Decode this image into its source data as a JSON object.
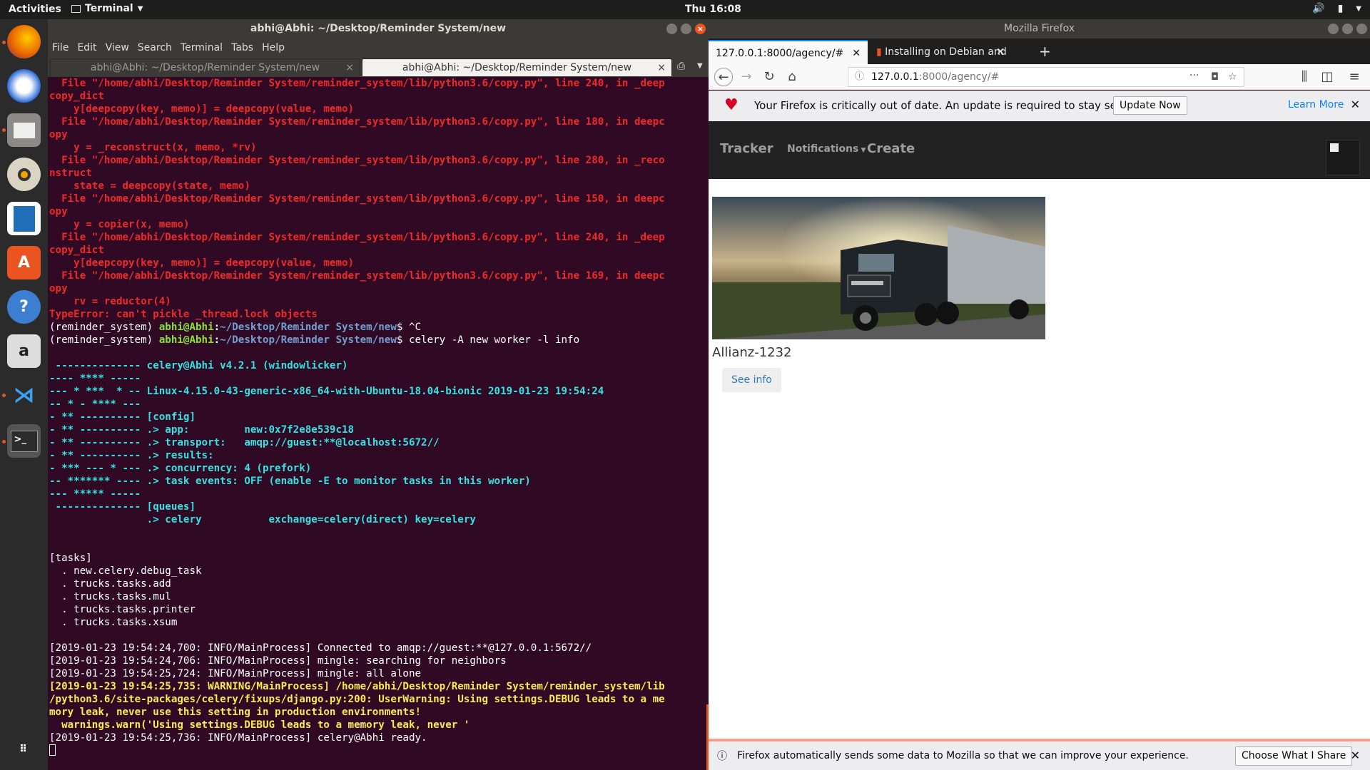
{
  "topbar": {
    "activities": "Activities",
    "app_menu": "Terminal",
    "clock": "Thu 16:08"
  },
  "dock": {
    "items": [
      "firefox-icon",
      "thunderbird-icon",
      "files-icon",
      "rhythmbox-icon",
      "writer-icon",
      "software-icon",
      "help-icon",
      "amazon-icon",
      "vscode-icon",
      "terminal-icon",
      "show-apps-icon"
    ]
  },
  "terminal": {
    "title": "abhi@Abhi: ~/Desktop/Reminder System/new",
    "menu": [
      "File",
      "Edit",
      "View",
      "Search",
      "Terminal",
      "Tabs",
      "Help"
    ],
    "tabs": [
      "abhi@Abhi: ~/Desktop/Reminder System/new",
      "abhi@Abhi: ~/Desktop/Reminder System/new"
    ],
    "lines": [
      {
        "c": "red",
        "t": "  File \"/home/abhi/Desktop/Reminder System/reminder_system/lib/python3.6/copy.py\", line 240, in _deep"
      },
      {
        "c": "red",
        "t": "copy_dict"
      },
      {
        "c": "red",
        "t": "    y[deepcopy(key, memo)] = deepcopy(value, memo)"
      },
      {
        "c": "red",
        "t": "  File \"/home/abhi/Desktop/Reminder System/reminder_system/lib/python3.6/copy.py\", line 180, in deepc"
      },
      {
        "c": "red",
        "t": "opy"
      },
      {
        "c": "red",
        "t": "    y = _reconstruct(x, memo, *rv)"
      },
      {
        "c": "red",
        "t": "  File \"/home/abhi/Desktop/Reminder System/reminder_system/lib/python3.6/copy.py\", line 280, in _reco"
      },
      {
        "c": "red",
        "t": "nstruct"
      },
      {
        "c": "red",
        "t": "    state = deepcopy(state, memo)"
      },
      {
        "c": "red",
        "t": "  File \"/home/abhi/Desktop/Reminder System/reminder_system/lib/python3.6/copy.py\", line 150, in deepc"
      },
      {
        "c": "red",
        "t": "opy"
      },
      {
        "c": "red",
        "t": "    y = copier(x, memo)"
      },
      {
        "c": "red",
        "t": "  File \"/home/abhi/Desktop/Reminder System/reminder_system/lib/python3.6/copy.py\", line 240, in _deep"
      },
      {
        "c": "red",
        "t": "copy_dict"
      },
      {
        "c": "red",
        "t": "    y[deepcopy(key, memo)] = deepcopy(value, memo)"
      },
      {
        "c": "red",
        "t": "  File \"/home/abhi/Desktop/Reminder System/reminder_system/lib/python3.6/copy.py\", line 169, in deepc"
      },
      {
        "c": "red",
        "t": "opy"
      },
      {
        "c": "red",
        "t": "    rv = reductor(4)"
      },
      {
        "c": "red",
        "t": "TypeError: can't pickle _thread.lock objects"
      },
      {
        "c": "prompt",
        "env": "(reminder_system) ",
        "user": "abhi@Abhi",
        "path": "~/Desktop/Reminder System/new",
        "cmd": "$ ^C"
      },
      {
        "c": "prompt",
        "env": "(reminder_system) ",
        "user": "abhi@Abhi",
        "path": "~/Desktop/Reminder System/new",
        "cmd": "$ celery -A new worker -l info"
      },
      {
        "c": "white",
        "t": ""
      },
      {
        "c": "cyan",
        "t": " -------------- celery@Abhi v4.2.1 (windowlicker)"
      },
      {
        "c": "cyan",
        "t": "---- **** -----"
      },
      {
        "c": "cyan",
        "t": "--- * ***  * -- Linux-4.15.0-43-generic-x86_64-with-Ubuntu-18.04-bionic 2019-01-23 19:54:24"
      },
      {
        "c": "cyan",
        "t": "-- * - **** ---"
      },
      {
        "c": "cyan",
        "t": "- ** ---------- [config]"
      },
      {
        "c": "cyan",
        "t": "- ** ---------- .> app:         new:0x7f2e8e539c18"
      },
      {
        "c": "cyan",
        "t": "- ** ---------- .> transport:   amqp://guest:**@localhost:5672//"
      },
      {
        "c": "cyan",
        "t": "- ** ---------- .> results:"
      },
      {
        "c": "cyan",
        "t": "- *** --- * --- .> concurrency: 4 (prefork)"
      },
      {
        "c": "cyan",
        "t": "-- ******* ---- .> task events: OFF (enable -E to monitor tasks in this worker)"
      },
      {
        "c": "cyan",
        "t": "--- ***** -----"
      },
      {
        "c": "cyan",
        "t": " -------------- [queues]"
      },
      {
        "c": "cyan",
        "t": "                .> celery           exchange=celery(direct) key=celery"
      },
      {
        "c": "white",
        "t": ""
      },
      {
        "c": "white",
        "t": ""
      },
      {
        "c": "white",
        "t": "[tasks]"
      },
      {
        "c": "white",
        "t": "  . new.celery.debug_task"
      },
      {
        "c": "white",
        "t": "  . trucks.tasks.add"
      },
      {
        "c": "white",
        "t": "  . trucks.tasks.mul"
      },
      {
        "c": "white",
        "t": "  . trucks.tasks.printer"
      },
      {
        "c": "white",
        "t": "  . trucks.tasks.xsum"
      },
      {
        "c": "white",
        "t": ""
      },
      {
        "c": "white",
        "t": "[2019-01-23 19:54:24,700: INFO/MainProcess] Connected to amqp://guest:**@127.0.0.1:5672//"
      },
      {
        "c": "white",
        "t": "[2019-01-23 19:54:24,706: INFO/MainProcess] mingle: searching for neighbors"
      },
      {
        "c": "white",
        "t": "[2019-01-23 19:54:25,724: INFO/MainProcess] mingle: all alone"
      },
      {
        "c": "yellow",
        "t": "[2019-01-23 19:54:25,735: WARNING/MainProcess] /home/abhi/Desktop/Reminder System/reminder_system/lib"
      },
      {
        "c": "yellow",
        "t": "/python3.6/site-packages/celery/fixups/django.py:200: UserWarning: Using settings.DEBUG leads to a me"
      },
      {
        "c": "yellow",
        "t": "mory leak, never use this setting in production environments!"
      },
      {
        "c": "yellow",
        "t": "  warnings.warn('Using settings.DEBUG leads to a memory leak, never '"
      },
      {
        "c": "white",
        "t": "[2019-01-23 19:54:25,736: INFO/MainProcess] celery@Abhi ready."
      }
    ]
  },
  "firefox": {
    "title": "Mozilla Firefox",
    "tabs": [
      {
        "label": "127.0.0.1:8000/agency/#",
        "active": true
      },
      {
        "label": "Installing on Debian and",
        "active": false
      }
    ],
    "url_host": "127.0.0.1",
    "url_rest": ":8000/agency/#",
    "notice": {
      "text": "Your Firefox is critically out of date. An update is required to stay secure.",
      "update_button": "Update Now",
      "learn_more": "Learn More"
    },
    "page": {
      "brand": "Tracker",
      "notifications": "Notifications",
      "create": "Create",
      "agency_name": "Allianz-1232",
      "see_info": "See info"
    },
    "bottom_bar": {
      "text": "Firefox automatically sends some data to Mozilla so that we can improve your experience.",
      "button": "Choose What I Share"
    }
  },
  "colors": {
    "terminal_bg": "#300a24",
    "error_red": "#ef2929",
    "celery_cyan": "#34e2e2",
    "warning_yellow": "#fce94f",
    "prompt_green": "#8ae234",
    "path_blue": "#729fcf",
    "accent": "#e95420"
  }
}
